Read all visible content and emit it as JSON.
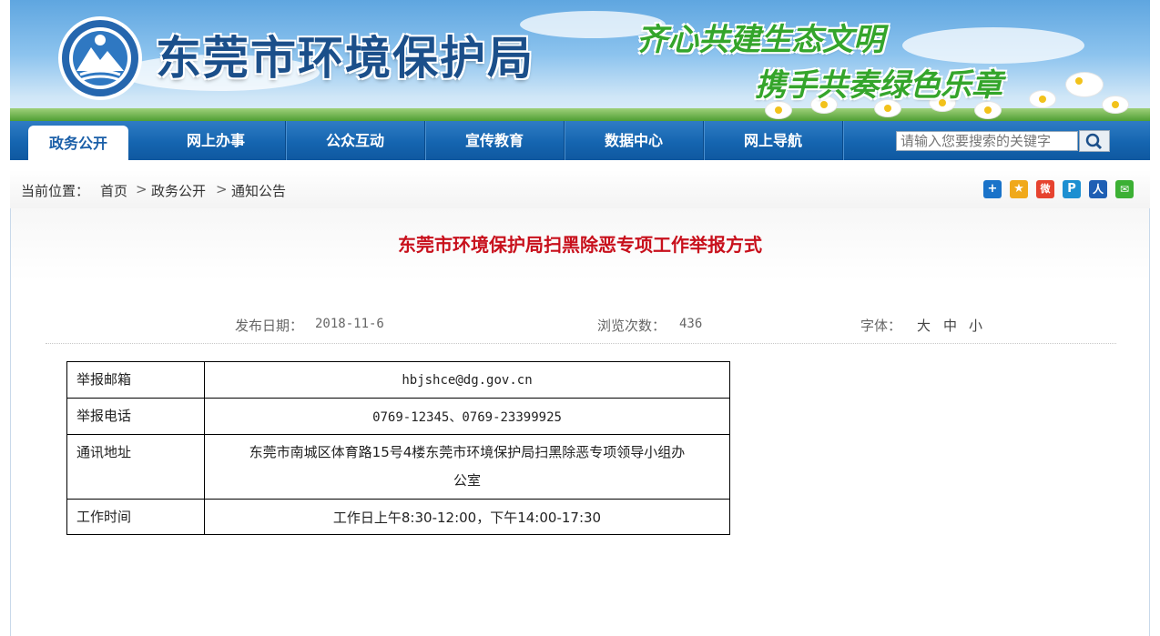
{
  "header": {
    "site_name": "东莞市环境保护局",
    "slogan_line1": "齐心共建生态文明",
    "slogan_line2": "携手共奏绿色乐章"
  },
  "nav": {
    "items": [
      {
        "label": "政务公开",
        "active": true
      },
      {
        "label": "网上办事"
      },
      {
        "label": "公众互动"
      },
      {
        "label": "宣传教育"
      },
      {
        "label": "数据中心"
      },
      {
        "label": "网上导航"
      }
    ],
    "search_placeholder": "请输入您要搜索的关键字"
  },
  "breadcrumb": {
    "prefix": "当前位置：",
    "items": [
      "首页",
      "政务公开",
      "通知公告"
    ],
    "separator": ">"
  },
  "share_icons": [
    {
      "name": "add-share-icon",
      "glyph": "+",
      "color": "#1a73c9"
    },
    {
      "name": "qzone-icon",
      "glyph": "★",
      "color": "#f0a91b"
    },
    {
      "name": "weibo-icon",
      "glyph": "微",
      "color": "#e6432f"
    },
    {
      "name": "tencent-weibo-icon",
      "glyph": "P",
      "color": "#1d8fd1"
    },
    {
      "name": "renren-icon",
      "glyph": "人",
      "color": "#1f5fb4"
    },
    {
      "name": "wechat-icon",
      "glyph": "✉",
      "color": "#3cb034"
    }
  ],
  "article": {
    "title": "东莞市环境保护局扫黑除恶专项工作举报方式",
    "date_label": "发布日期：",
    "date": "2018-11-6",
    "views_label": "浏览次数：",
    "views": "436",
    "font_label": "字体：",
    "font_sizes": [
      "大",
      "中",
      "小"
    ]
  },
  "info_table": {
    "rows": [
      {
        "key": "举报邮箱",
        "value": "hbjshce@dg.gov.cn"
      },
      {
        "key": "举报电话",
        "value": "0769-12345、0769-23399925"
      },
      {
        "key": "通讯地址",
        "value_line1": "东莞市南城区体育路15号4楼东莞市环境保护局扫黑除恶专项领导小组办",
        "value_line2": "公室"
      },
      {
        "key": "工作时间",
        "value": "工作日上午8:30-12:00，下午14:00-17:30"
      }
    ]
  },
  "colors": {
    "nav_blue": "#1565b0",
    "title_red": "#c8101c",
    "site_name_blue": "#1b4f8a",
    "slogan_green": "#34a52b"
  }
}
